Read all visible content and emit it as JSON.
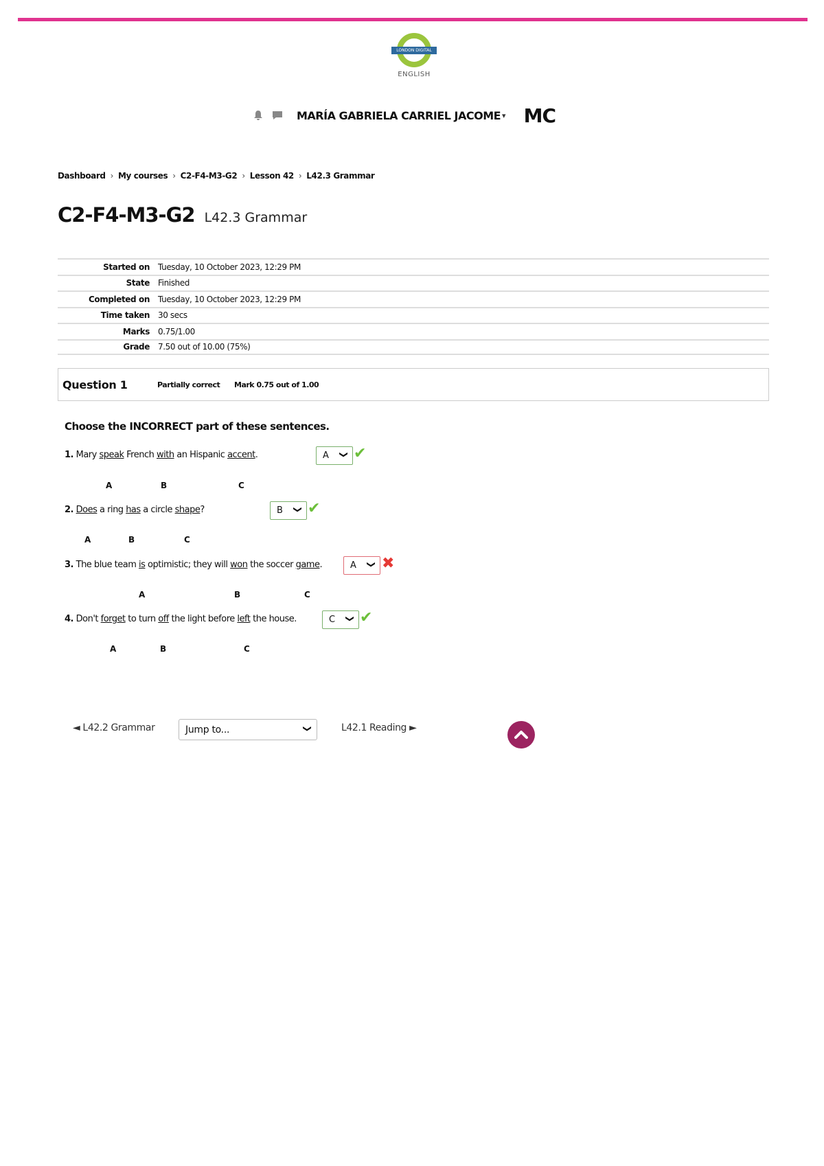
{
  "brand": {
    "logo_bar_text": "LONDON DIGITAL",
    "logo_text": "ENGLISH",
    "accent_color": "#e0338f",
    "logo_ring_color": "#9bc53d"
  },
  "user": {
    "name": "MARÍA GABRIELA CARRIEL JACOME",
    "initials": "MC",
    "icons": [
      "bell-icon",
      "chat-icon"
    ]
  },
  "breadcrumb": [
    "Dashboard",
    "My courses",
    "C2-F4-M3-G2",
    "Lesson 42",
    "L42.3 Grammar"
  ],
  "page": {
    "course": "C2-F4-M3-G2",
    "activity": "L42.3 Grammar"
  },
  "summary": [
    {
      "label": "Started on",
      "value": "Tuesday, 10 October 2023, 12:29 PM"
    },
    {
      "label": "State",
      "value": "Finished"
    },
    {
      "label": "Completed on",
      "value": "Tuesday, 10 October 2023, 12:29 PM"
    },
    {
      "label": "Time taken",
      "value": "30 secs"
    },
    {
      "label": "Marks",
      "value": "0.75/1.00"
    },
    {
      "label": "Grade",
      "value": "7.50 out of 10.00 (75%)"
    }
  ],
  "question": {
    "number": "Question 1",
    "state": "Partially correct",
    "mark": "Mark 0.75 out of 1.00",
    "instruction": "Choose the INCORRECT part of these sentences.",
    "items": [
      {
        "num": "1.",
        "parts": [
          "Mary ",
          "speak",
          " French ",
          "with",
          " an Hispanic ",
          "accent",
          "."
        ],
        "answer": "A",
        "correct": true,
        "letters": [
          "A",
          "B",
          "C"
        ]
      },
      {
        "num": "2.",
        "parts": [
          "",
          "Does",
          " a ring ",
          "has",
          " a circle ",
          "shape",
          "?"
        ],
        "answer": "B",
        "correct": true,
        "letters": [
          "A",
          "B",
          "C"
        ]
      },
      {
        "num": "3.",
        "parts": [
          "The blue team ",
          "is",
          " optimistic; they will ",
          "won",
          " the soccer ",
          "game",
          "."
        ],
        "answer": "A",
        "correct": false,
        "letters": [
          "A",
          "B",
          "C"
        ]
      },
      {
        "num": "4.",
        "parts": [
          "Don't ",
          "forget",
          " to turn ",
          "off",
          " the light before ",
          "left",
          " the house."
        ],
        "answer": "C",
        "correct": true,
        "letters": [
          "A",
          "B",
          "C"
        ]
      }
    ]
  },
  "nav": {
    "prev": "◄ L42.2 Grammar",
    "jump": "Jump to...",
    "next": "L42.1 Reading ►"
  }
}
